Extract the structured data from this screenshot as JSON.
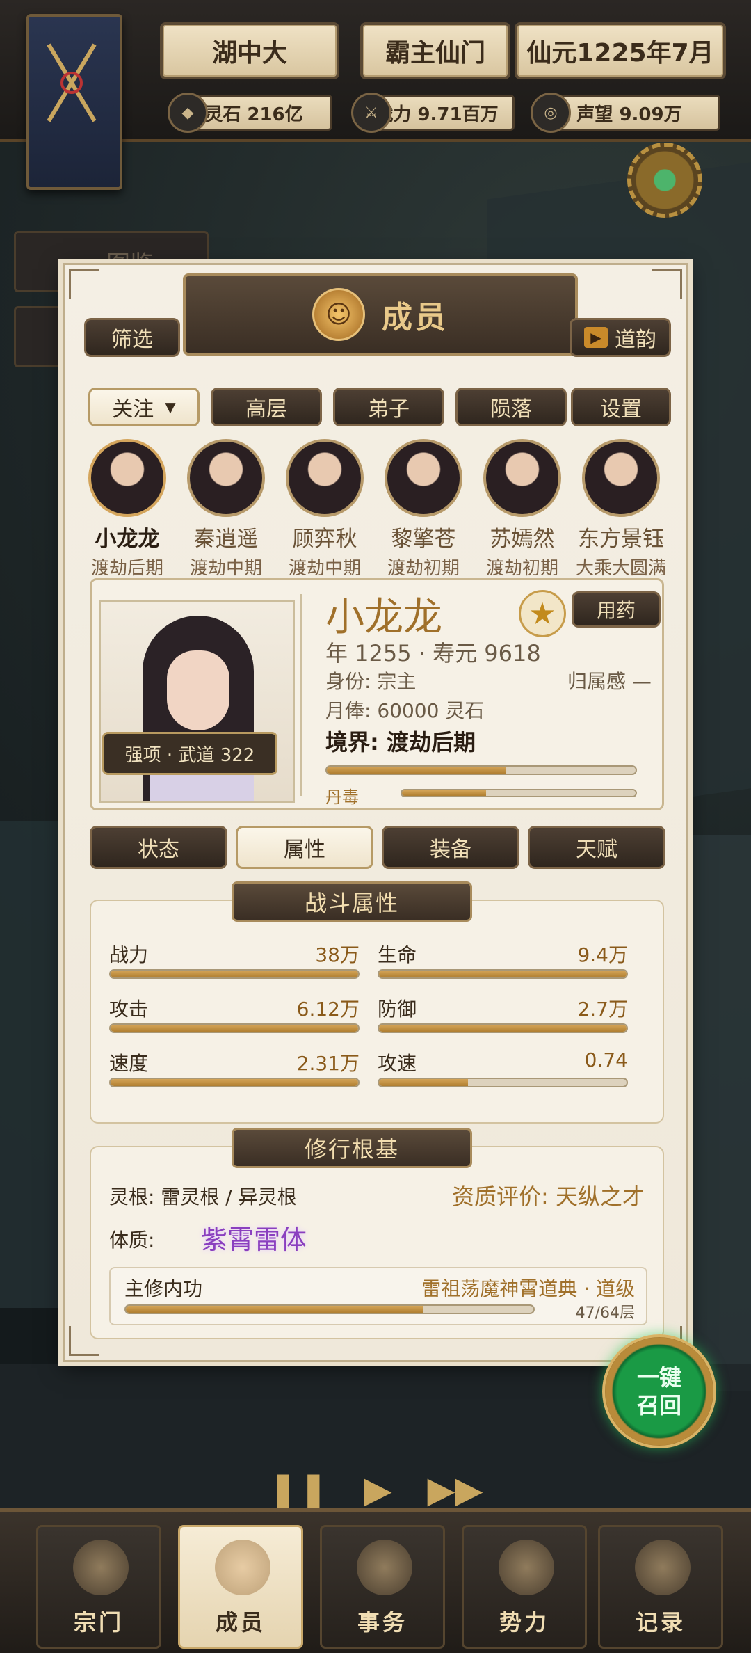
{
  "header": {
    "region": "湖中大",
    "sect": "霸主仙门",
    "date": "仙元1225年7月",
    "resources": [
      {
        "icon": "spirit-stone-icon",
        "label": "灵石 216亿"
      },
      {
        "icon": "power-icon",
        "label": "战力 9.71百万"
      },
      {
        "icon": "reputation-icon",
        "label": "声望 9.09万"
      }
    ]
  },
  "side": {
    "tab_label": "图鉴"
  },
  "panel": {
    "title": "成员",
    "filter_label": "筛选",
    "daoyun_label": "道韵",
    "category_select": "关注",
    "category_tabs": [
      "高层",
      "弟子",
      "陨落",
      "设置"
    ]
  },
  "members": [
    {
      "name": "小龙龙",
      "rank": "渡劫后期"
    },
    {
      "name": "秦逍遥",
      "rank": "渡劫中期"
    },
    {
      "name": "顾弈秋",
      "rank": "渡劫中期"
    },
    {
      "name": "黎擎苍",
      "rank": "渡劫初期"
    },
    {
      "name": "苏嫣然",
      "rank": "渡劫初期"
    },
    {
      "name": "东方景钰",
      "rank": "大乘大圆满"
    }
  ],
  "detail": {
    "name": "小龙龙",
    "medicine_label": "用药",
    "age_line": "年 1255 · 寿元 9618",
    "identity": "身份: 宗主",
    "belonging": "归属感 —",
    "salary": "月俸: 60000 灵石",
    "realm": "境界: 渡劫后期",
    "realm_progress": 0.58,
    "poison_label": "丹毒",
    "poison_progress": 0.36,
    "strength": "强项 · 武道 322"
  },
  "detail_tabs": [
    "状态",
    "属性",
    "装备",
    "天赋"
  ],
  "combat": {
    "title": "战斗属性",
    "stats": [
      {
        "label": "战力",
        "value": "38万",
        "fill": 1.0
      },
      {
        "label": "生命",
        "value": "9.4万",
        "fill": 1.0
      },
      {
        "label": "攻击",
        "value": "6.12万",
        "fill": 1.0
      },
      {
        "label": "防御",
        "value": "2.7万",
        "fill": 1.0
      },
      {
        "label": "速度",
        "value": "2.31万",
        "fill": 1.0
      },
      {
        "label": "攻速",
        "value": "0.74",
        "fill": 0.36
      }
    ]
  },
  "foundation": {
    "title": "修行根基",
    "root": "灵根: 雷灵根 / 异灵根",
    "aptitude": "资质评价: 天纵之才",
    "physique_label": "体质:",
    "physique": "紫霄雷体",
    "technique_label": "主修内功",
    "technique": "雷祖荡魔神霄道典 · 道级",
    "technique_progress": 0.73,
    "technique_level": "47/64层"
  },
  "recall": {
    "line1": "一键",
    "line2": "召回"
  },
  "nav": [
    {
      "label": "宗门",
      "icon": "pagoda-icon"
    },
    {
      "label": "成员",
      "icon": "member-icon"
    },
    {
      "label": "事务",
      "icon": "scroll-icon"
    },
    {
      "label": "势力",
      "icon": "flag-icon"
    },
    {
      "label": "记录",
      "icon": "book-icon"
    }
  ],
  "playback": {
    "pause": "❚❚",
    "play": "▶",
    "fast": "▶▶"
  }
}
